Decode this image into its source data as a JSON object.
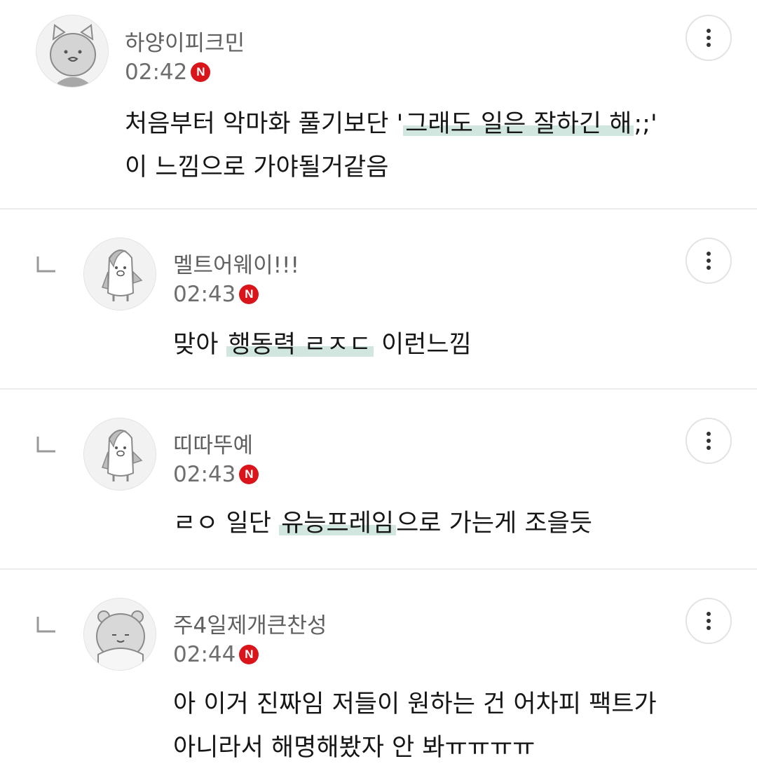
{
  "comments": [
    {
      "username": "하양이피크민",
      "time": "02:42",
      "badge": "N",
      "avatar": "cat-avatar-icon",
      "is_reply": false,
      "lines": [
        {
          "before": "처음부터 악마화 풀기보단 '",
          "highlight": "그래도 일은 잘하긴 해",
          "after": ";;'"
        },
        {
          "before": "이 느낌으로 가야될거같음",
          "highlight": "",
          "after": ""
        }
      ]
    },
    {
      "username": "멜트어웨이!!!",
      "time": "02:43",
      "badge": "N",
      "avatar": "penguin-avatar-icon",
      "is_reply": true,
      "lines": [
        {
          "before": "맞아 ",
          "highlight": "행동력 ㄹㅈㄷ",
          "after": " 이런느낌"
        }
      ]
    },
    {
      "username": "띠따뚜예",
      "time": "02:43",
      "badge": "N",
      "avatar": "penguin-avatar-icon",
      "is_reply": true,
      "lines": [
        {
          "before": "ㄹㅇ 일단 ",
          "highlight": "유능프레임",
          "after": "으로 가는게 조을듯"
        }
      ]
    },
    {
      "username": "주4일제개큰찬성",
      "time": "02:44",
      "badge": "N",
      "avatar": "hamster-avatar-icon",
      "is_reply": true,
      "lines": [
        {
          "before": "아 이거 진짜임 저들이 원하는 건 어차피 팩트가",
          "highlight": "",
          "after": ""
        },
        {
          "before": "아니라서 해명해봤자 안 봐ㅠㅠㅠㅠ",
          "highlight": "",
          "after": ""
        }
      ]
    }
  ],
  "colors": {
    "badge": "#d9141b",
    "highlight": "#aad2c4",
    "username": "#606060",
    "divider": "#ececec"
  }
}
